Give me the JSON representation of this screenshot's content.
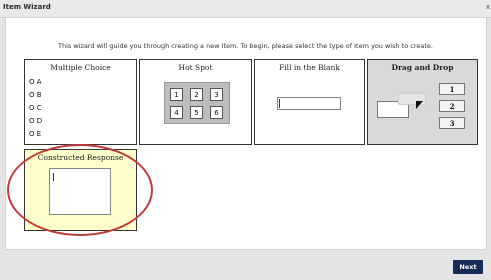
{
  "window": {
    "title": "Item Wizard",
    "close_glyph": "x"
  },
  "intro": "This wizard will guide you through creating a new Item. To begin, please select the type of Item you wish to create.",
  "item_types": {
    "multiple_choice": {
      "title": "Multiple Choice",
      "options": [
        "O A",
        "O B",
        "O C",
        "O D",
        "O E"
      ]
    },
    "hot_spot": {
      "title": "Hot Spot",
      "cells": [
        "1",
        "2",
        "3",
        "4",
        "5",
        "6"
      ]
    },
    "fill_blank": {
      "title": "Fill in the Blank"
    },
    "drag_drop": {
      "title": "Drag and Drop",
      "chips": [
        "1",
        "2",
        "3"
      ]
    },
    "constructed_response": {
      "title": "Constructed Response",
      "highlight_color": "#c43a3a"
    }
  },
  "footer": {
    "next_label": "Next"
  }
}
